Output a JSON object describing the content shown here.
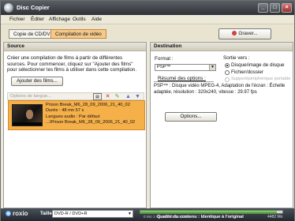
{
  "window": {
    "title": "Disc Copier"
  },
  "menu": [
    "Fichier",
    "Éditer",
    "Affichage",
    "Outils",
    "Aide"
  ],
  "tabs": [
    {
      "label": "Copie de CD/DVD",
      "active": false
    },
    {
      "label": "Compilation de vidéo",
      "active": true
    }
  ],
  "toolbar": {
    "burn_label": "Graver..."
  },
  "source": {
    "title": "Source",
    "instructions": [
      "Créer une compilation de films à partir de différentes",
      "sources. Pour commencer, cliquez sur \"Ajouter des films\"",
      "pour sélectionner les films à utiliser dans cette compilation."
    ],
    "add_button": "Ajouter des films...",
    "options_language": "Options de langue...",
    "items": [
      {
        "name": "Prison Break_M6_28_09_2006_21_40_02",
        "duration": "Durée : 48 mn 57 s",
        "language": "Langues audio : Par défaut",
        "path": "...\\Prison Break_M6_28_09_2006_21_40_02"
      }
    ]
  },
  "destination": {
    "title": "Destination",
    "format_label": "Format :",
    "format_value": "PSP™",
    "summary_link": "Résumé des options :",
    "summary_text": [
      "PSP™ : Disque vidéo MPEG-4, Adaptation de l'écran : Échelle",
      "adaptée, résolution : 320x240, vitesse : 29.97 fps"
    ],
    "options_button": "Options...",
    "output_label": "Sortie vers :",
    "output_options": [
      {
        "label": "Disque/image de disque",
        "selected": true,
        "enabled": true
      },
      {
        "label": "Fichier/dossier",
        "selected": false,
        "enabled": true
      },
      {
        "label": "Support/périphérique portable",
        "selected": false,
        "enabled": false
      }
    ]
  },
  "status": {
    "brand": "roxio",
    "size_label": "Taille",
    "size_value": "DVD-R / DVD+R",
    "scale_marks": "0 Mo    1 Go    2 Go    3 Go    4 Go",
    "quality_text": "Qualité du contenu : Identique à l'original",
    "used_size": "4482 Mo",
    "progress_fraction": 0.96
  },
  "colors": {
    "active_tab": "#f5c98a",
    "selected_item": "#f6b04a",
    "progress_fill": "#3ca11b"
  }
}
